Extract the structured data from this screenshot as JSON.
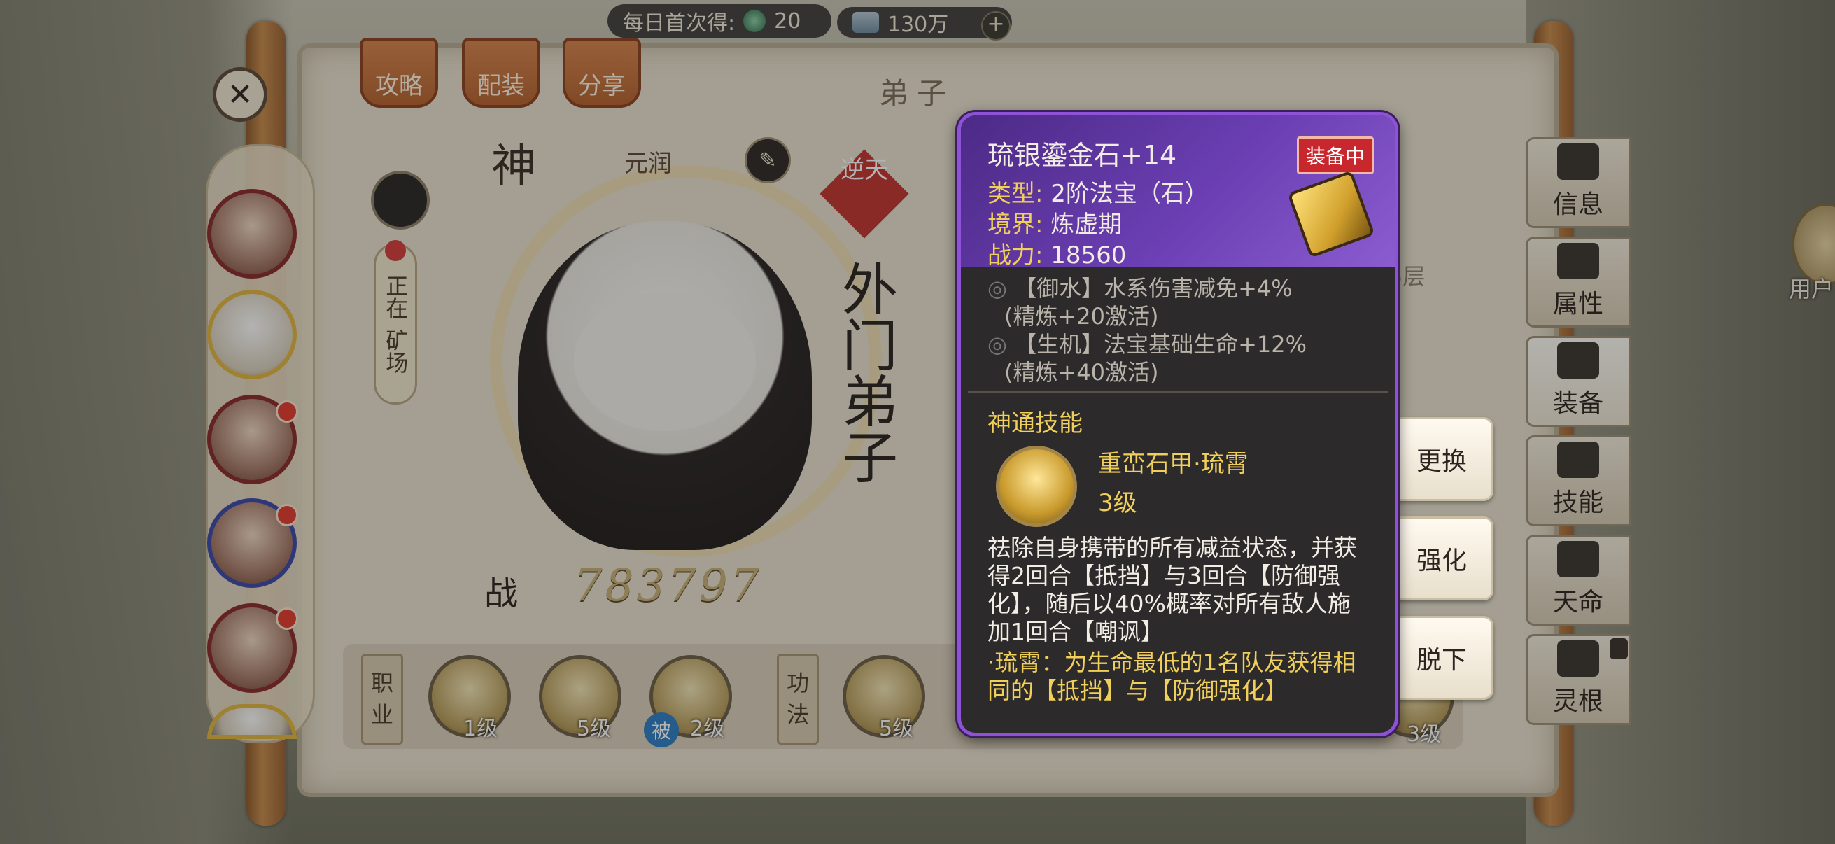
{
  "currency": {
    "daily_label": "每日首次得:",
    "daily_amount": "20",
    "scrolls": "130万",
    "plus": "+"
  },
  "top_tabs": [
    "攻略",
    "配装",
    "分享"
  ],
  "title": "弟子",
  "character": {
    "rank_glyph": "神",
    "name": "元润",
    "title_badge": "逆天",
    "status_chars": [
      "正在",
      "矿场"
    ],
    "calligraphy": "外门弟子",
    "power_label": "战",
    "power_value": "783797"
  },
  "skill_row": {
    "career_label": [
      "职",
      "业"
    ],
    "gongfa_label": [
      "功",
      "法"
    ],
    "levels": [
      "1级",
      "5级",
      "2级",
      "5级",
      "3级"
    ],
    "passive_tag": "被"
  },
  "side_tabs": [
    "信息",
    "属性",
    "装备",
    "技能",
    "天命",
    "灵根"
  ],
  "right_edge": {
    "user_label": "用户"
  },
  "behind_fragments": {
    "layers": "5层"
  },
  "actions": [
    "更换",
    "强化",
    "脱下"
  ],
  "tooltip": {
    "item_name": "琉银鎏金石+14",
    "equipped_badge": "装备中",
    "type_label": "类型:",
    "type_value": "2阶法宝（石）",
    "realm_label": "境界:",
    "realm_value": "炼虚期",
    "power_label": "战力:",
    "power_value": "18560",
    "effects": [
      {
        "text": "【御水】水系伤害减免+4%",
        "note": "(精炼+20激活)"
      },
      {
        "text": "【生机】法宝基础生命+12%",
        "note": "(精炼+40激活)"
      }
    ],
    "section_title": "神通技能",
    "skill_name": "重峦石甲·琉霄",
    "skill_level": "3级",
    "description": "祛除自身携带的所有减益状态，并获得2回合【抵挡】与3回合【防御强化】，随后以40%概率对所有敌人施加1回合【嘲讽】",
    "extra": "·琉霄：为生命最低的1名队友获得相同的【抵挡】与【防御强化】"
  },
  "colors": {
    "tooltip_border": "#8d52d6",
    "gold_text": "#f0cf5b",
    "badge_red": "#c8282d"
  }
}
